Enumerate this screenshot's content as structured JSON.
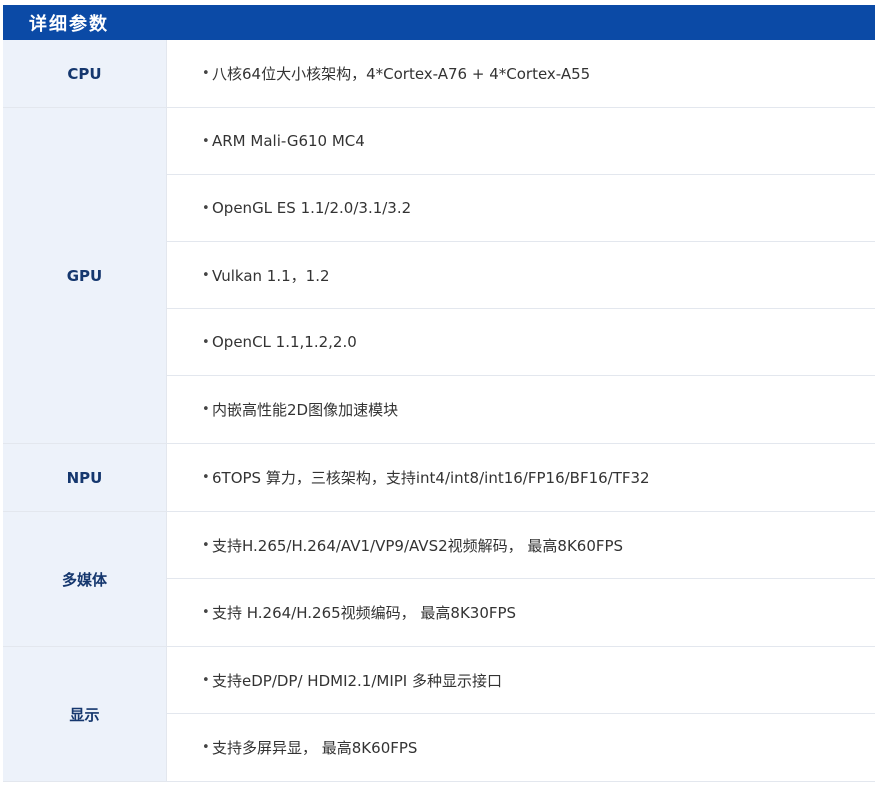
{
  "header": {
    "title": "详细参数"
  },
  "bullet": "•",
  "rows": [
    {
      "label": "CPU",
      "items": [
        "八核64位大小核架构，4*Cortex-A76 + 4*Cortex-A55"
      ]
    },
    {
      "label": "GPU",
      "items": [
        "ARM Mali-G610 MC4",
        "OpenGL ES 1.1/2.0/3.1/3.2",
        "Vulkan 1.1，1.2",
        "OpenCL 1.1,1.2,2.0",
        "内嵌高性能2D图像加速模块"
      ]
    },
    {
      "label": "NPU",
      "items": [
        "6TOPS 算力，三核架构，支持int4/int8/int16/FP16/BF16/TF32"
      ]
    },
    {
      "label": "多媒体",
      "items": [
        "支持H.265/H.264/AV1/VP9/AVS2视频解码， 最高8K60FPS",
        "支持 H.264/H.265视频编码， 最高8K30FPS"
      ]
    },
    {
      "label": "显示",
      "items": [
        "支持eDP/DP/ HDMI2.1/MIPI 多种显示接口",
        "支持多屏异显， 最高8K60FPS"
      ]
    }
  ]
}
